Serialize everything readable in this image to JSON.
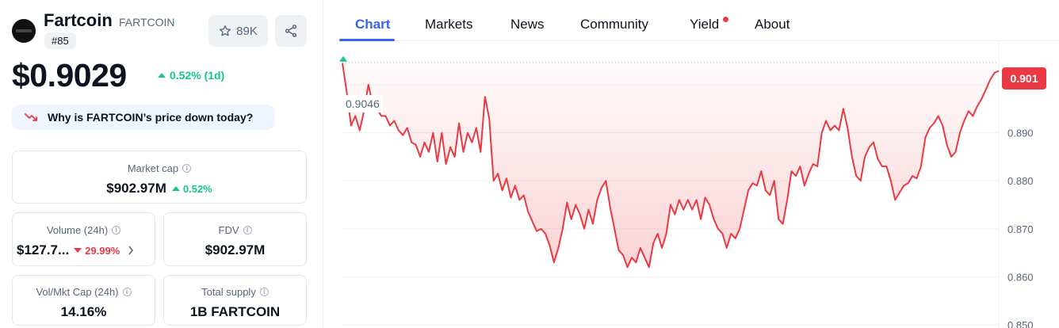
{
  "coin": {
    "name": "Fartcoin",
    "symbol": "FARTCOIN",
    "rank": "#85",
    "watchlist_count": "89K",
    "price": "$0.9029",
    "change_1d": "0.52% (1d)",
    "why_prompt": "Why is FARTCOIN’s price down today?"
  },
  "stats": {
    "market_cap": {
      "label": "Market cap",
      "value": "$902.97M",
      "change": "0.52%"
    },
    "volume": {
      "label": "Volume (24h)",
      "value": "$127.7...",
      "change": "29.99%"
    },
    "fdv": {
      "label": "FDV",
      "value": "$902.97M"
    },
    "vol_mkt_cap": {
      "label": "Vol/Mkt Cap (24h)",
      "value": "14.16%"
    },
    "total_supply": {
      "label": "Total supply",
      "value": "1B FARTCOIN"
    }
  },
  "tabs": [
    {
      "label": "Chart",
      "active": true
    },
    {
      "label": "Markets"
    },
    {
      "label": "News"
    },
    {
      "label": "Community"
    },
    {
      "label": "Yield",
      "dot": true
    },
    {
      "label": "About"
    }
  ],
  "colors": {
    "green": "#16c784",
    "red": "#ea3943",
    "blue": "#3861fb"
  },
  "icons": {
    "star": "star-icon",
    "share": "share-icon",
    "trend_down": "trend-down-icon",
    "info": "info-icon",
    "chevron": "chevron-right-icon"
  },
  "chart_data": {
    "type": "line",
    "start_label": "0.9046",
    "current_price_label": "0.901",
    "y_ticks": [
      "0.850",
      "0.860",
      "0.870",
      "0.880",
      "0.890",
      "0.900"
    ],
    "ylim": [
      0.849,
      0.913
    ],
    "series": [
      {
        "values": [
          0.9045,
          0.8985,
          0.8915,
          0.8935,
          0.8905,
          0.8945,
          0.9,
          0.896,
          0.895,
          0.8935,
          0.8935,
          0.8915,
          0.8925,
          0.8905,
          0.8895,
          0.891,
          0.888,
          0.8875,
          0.885,
          0.888,
          0.886,
          0.89,
          0.884,
          0.89,
          0.8835,
          0.887,
          0.885,
          0.892,
          0.886,
          0.89,
          0.888,
          0.891,
          0.886,
          0.8975,
          0.893,
          0.88,
          0.8815,
          0.878,
          0.8805,
          0.8765,
          0.879,
          0.876,
          0.877,
          0.8735,
          0.8715,
          0.8695,
          0.87,
          0.869,
          0.8665,
          0.863,
          0.866,
          0.87,
          0.8755,
          0.872,
          0.875,
          0.873,
          0.87,
          0.874,
          0.871,
          0.876,
          0.8785,
          0.88,
          0.8745,
          0.87,
          0.8655,
          0.8645,
          0.862,
          0.864,
          0.863,
          0.866,
          0.864,
          0.862,
          0.867,
          0.869,
          0.866,
          0.869,
          0.875,
          0.873,
          0.876,
          0.874,
          0.876,
          0.874,
          0.876,
          0.872,
          0.8765,
          0.875,
          0.872,
          0.87,
          0.869,
          0.866,
          0.869,
          0.868,
          0.87,
          0.874,
          0.878,
          0.8795,
          0.879,
          0.882,
          0.878,
          0.877,
          0.88,
          0.872,
          0.871,
          0.876,
          0.882,
          0.881,
          0.883,
          0.879,
          0.8815,
          0.8835,
          0.883,
          0.89,
          0.8925,
          0.8905,
          0.8915,
          0.8905,
          0.895,
          0.891,
          0.885,
          0.881,
          0.88,
          0.885,
          0.887,
          0.888,
          0.8845,
          0.883,
          0.883,
          0.88,
          0.876,
          0.8775,
          0.879,
          0.8795,
          0.881,
          0.8805,
          0.883,
          0.889,
          0.891,
          0.892,
          0.8935,
          0.8915,
          0.8875,
          0.885,
          0.886,
          0.89,
          0.8925,
          0.8945,
          0.8935,
          0.8955,
          0.897,
          0.899,
          0.901,
          0.9025,
          0.9029
        ]
      }
    ]
  }
}
